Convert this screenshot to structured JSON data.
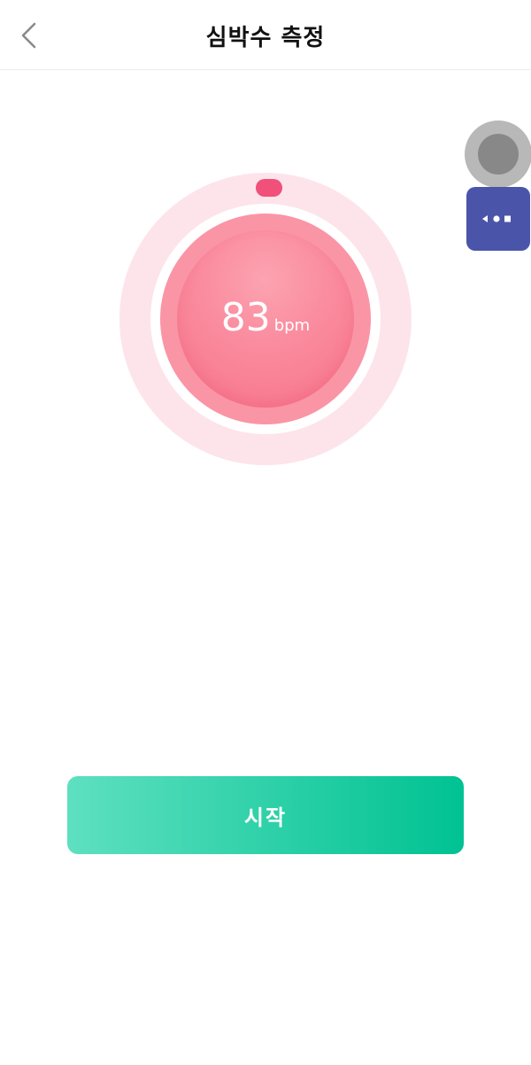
{
  "header": {
    "title": "심박수 측정",
    "back_icon": "chevron-left-icon"
  },
  "gauge": {
    "value": "83",
    "unit": "bpm",
    "colors": {
      "outer_ring": "#fde4ea",
      "inner_ring": "#fa95a6",
      "core": "#f7748a",
      "indicator": "#f0507a"
    }
  },
  "floating_controls": {
    "record_icon": "record-circle-icon",
    "menu_icon": "more-options-icon",
    "menu_color": "#4a55a9"
  },
  "actions": {
    "start_label": "시작",
    "start_colors": [
      "#5ee0c0",
      "#00c292"
    ]
  }
}
